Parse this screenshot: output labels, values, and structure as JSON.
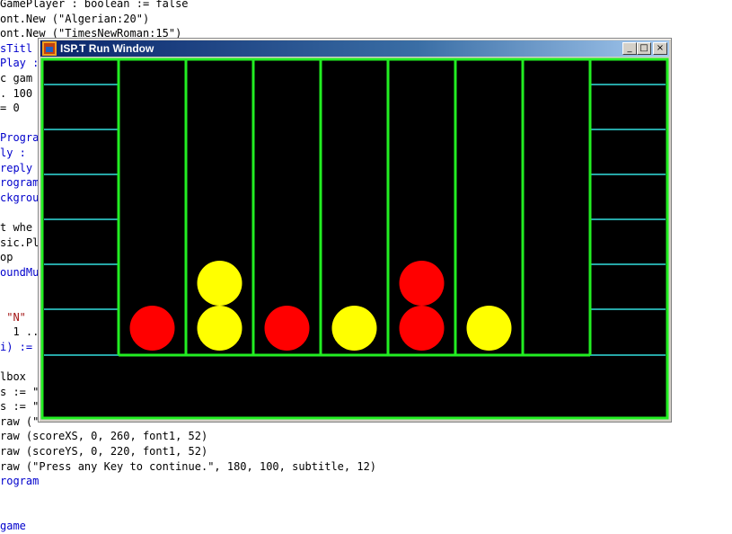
{
  "code": {
    "lines": [
      {
        "text": "GamePlayer : boolean := false",
        "color": "#000000"
      },
      {
        "text": "ont.New (\"Algerian:20\")",
        "color": "#000000"
      },
      {
        "text": "ont.New (\"TimesNewRoman:15\")",
        "color": "#000000"
      },
      {
        "text": "sTitl",
        "color": "#0000cc"
      },
      {
        "text": "Play :",
        "color": "#0000cc"
      },
      {
        "text": "c gam",
        "color": "#000000"
      },
      {
        "text": ". 100",
        "color": "#000000"
      },
      {
        "text": "= 0",
        "color": "#000000"
      },
      {
        "text": "",
        "color": "#000000"
      },
      {
        "text": "Progra",
        "color": "#0000cc"
      },
      {
        "text": "ly :",
        "color": "#0000cc"
      },
      {
        "text": "reply",
        "color": "#0000cc"
      },
      {
        "text": "rogram",
        "color": "#0000cc"
      },
      {
        "text": "ckgrou",
        "color": "#0000cc"
      },
      {
        "text": "",
        "color": "#000000"
      },
      {
        "text": "t whe",
        "color": "#000000"
      },
      {
        "text": "sic.Pl",
        "color": "#000000"
      },
      {
        "text": "op",
        "color": "#000000"
      },
      {
        "text": "oundMu",
        "color": "#0000cc"
      },
      {
        "text": "",
        "color": "#000000"
      },
      {
        "text": "",
        "color": "#000000"
      },
      {
        "text": " \"N\"",
        "color": "#a31515"
      },
      {
        "text": "  1 ..",
        "color": "#000000"
      },
      {
        "text": "i) :=",
        "color": "#0000cc"
      },
      {
        "text": "",
        "color": "#000000"
      },
      {
        "text": "lbox",
        "color": "#000000"
      },
      {
        "text": "s := \"",
        "color": "#000000"
      },
      {
        "text": "s := \"",
        "color": "#000000"
      },
      {
        "text": "raw (\"",
        "color": "#000000"
      },
      {
        "text": "raw (scoreXS, 0, 260, font1, 52)",
        "color": "#000000"
      },
      {
        "text": "raw (scoreYS, 0, 220, font1, 52)",
        "color": "#000000"
      },
      {
        "text": "raw (\"Press any Key to continue.\", 180, 100, subtitle, 12)",
        "color": "#000000"
      },
      {
        "text": "rogram",
        "color": "#0000cc"
      },
      {
        "text": "",
        "color": "#000000"
      },
      {
        "text": "",
        "color": "#000000"
      },
      {
        "text": "game",
        "color": "#0000cc"
      }
    ]
  },
  "window": {
    "title": "ISP.T Run Window",
    "minimize_label": "_",
    "maximize_label": "□",
    "close_label": "×"
  },
  "game": {
    "columns": 7,
    "rows": 7,
    "pieces": [
      {
        "column": 1,
        "row_from_bottom": 1,
        "color": "red"
      },
      {
        "column": 2,
        "row_from_bottom": 1,
        "color": "yellow"
      },
      {
        "column": 2,
        "row_from_bottom": 2,
        "color": "yellow"
      },
      {
        "column": 3,
        "row_from_bottom": 1,
        "color": "red"
      },
      {
        "column": 4,
        "row_from_bottom": 1,
        "color": "yellow"
      },
      {
        "column": 5,
        "row_from_bottom": 1,
        "color": "red"
      },
      {
        "column": 5,
        "row_from_bottom": 2,
        "color": "red"
      },
      {
        "column": 6,
        "row_from_bottom": 1,
        "color": "yellow"
      }
    ],
    "colors": {
      "background": "#000000",
      "frame": "#22ee22",
      "shelf_lines": "#33dddd",
      "red": "#ff0000",
      "yellow": "#ffff00"
    }
  }
}
